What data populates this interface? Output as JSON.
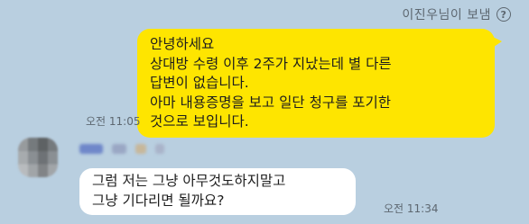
{
  "header": {
    "sender_label": "이진우님이 보냄",
    "help_glyph": "?"
  },
  "messages": [
    {
      "from": "me",
      "lines": [
        "안녕하세요",
        "상대방 수령 이후 2주가 지났는데 별 다른",
        "답변이 없습니다.",
        "아마 내용증명을 보고 일단 청구를 포기한",
        "것으로 보입니다."
      ],
      "time": "오전 11:05",
      "bubble_color": "#fee500"
    },
    {
      "from": "other",
      "lines": [
        "그럼 저는 그냥 아무것도하지말고",
        "그냥 기다리면 될까요?"
      ],
      "time": "오전 11:34",
      "bubble_color": "#ffffff"
    }
  ],
  "colors": {
    "chat_background": "#b9cfe0",
    "meta_text": "#5d6770"
  }
}
